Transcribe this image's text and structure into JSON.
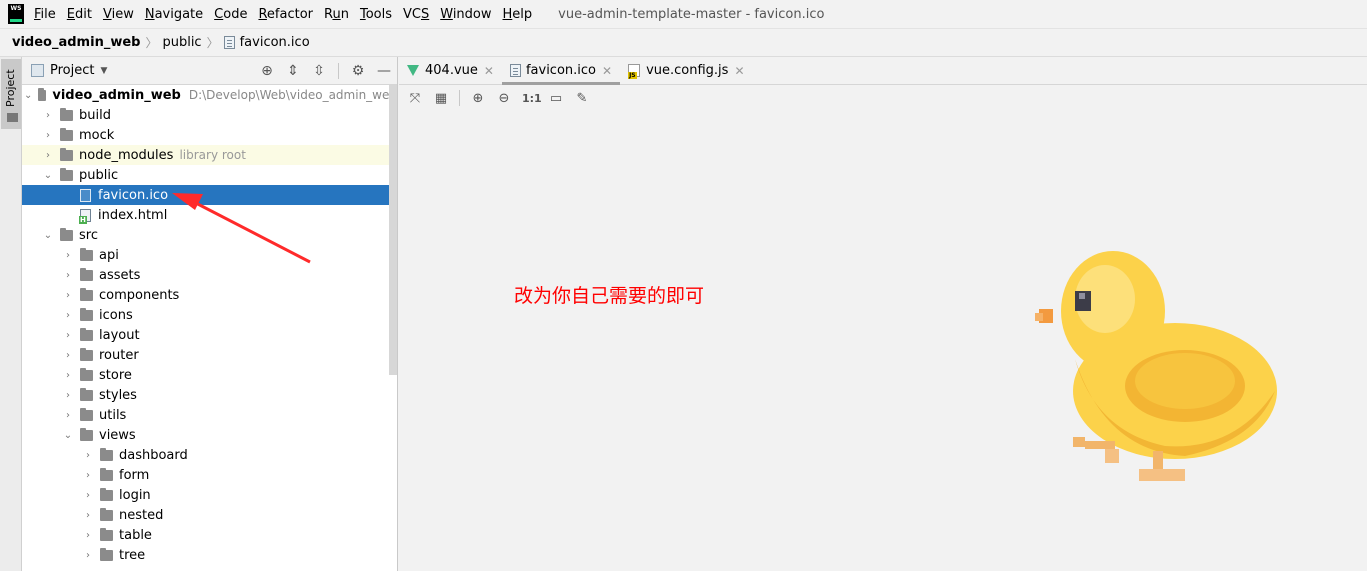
{
  "menubar": {
    "logo": "WS EAP",
    "items": [
      {
        "pre": "",
        "u": "F",
        "post": "ile"
      },
      {
        "pre": "",
        "u": "E",
        "post": "dit"
      },
      {
        "pre": "",
        "u": "V",
        "post": "iew"
      },
      {
        "pre": "",
        "u": "N",
        "post": "avigate"
      },
      {
        "pre": "",
        "u": "C",
        "post": "ode"
      },
      {
        "pre": "",
        "u": "R",
        "post": "efactor"
      },
      {
        "pre": "R",
        "u": "u",
        "post": "n"
      },
      {
        "pre": "",
        "u": "T",
        "post": "ools"
      },
      {
        "pre": "VC",
        "u": "S",
        "post": ""
      },
      {
        "pre": "",
        "u": "W",
        "post": "indow"
      },
      {
        "pre": "",
        "u": "H",
        "post": "elp"
      }
    ],
    "window_title": "vue-admin-template-master - favicon.ico"
  },
  "breadcrumb": {
    "root": "video_admin_web",
    "folder": "public",
    "file": "favicon.ico"
  },
  "left_strip": {
    "tab_label": "Project"
  },
  "project_panel": {
    "title": "Project",
    "root_name": "video_admin_web",
    "root_path": "D:\\Develop\\Web\\video_admin_web",
    "library_hint": "library root",
    "items": {
      "build": "build",
      "mock": "mock",
      "node_modules": "node_modules",
      "public": "public",
      "favicon": "favicon.ico",
      "index_html": "index.html",
      "src": "src",
      "api": "api",
      "assets": "assets",
      "components": "components",
      "icons": "icons",
      "layout": "layout",
      "router": "router",
      "store": "store",
      "styles": "styles",
      "utils": "utils",
      "views": "views",
      "dashboard": "dashboard",
      "form": "form",
      "login": "login",
      "nested": "nested",
      "table": "table",
      "tree": "tree"
    }
  },
  "editor": {
    "tabs": [
      {
        "label": "404.vue",
        "active": false
      },
      {
        "label": "favicon.ico",
        "active": true
      },
      {
        "label": "vue.config.js",
        "active": false
      }
    ],
    "toolbar": {
      "actual_size": "1:1"
    },
    "annotation": "改为你自己需要的即可",
    "annotation_color": "#ff0000"
  },
  "colors": {
    "selection": "#2675bf",
    "library_row": "#fbfbe4",
    "vue_green": "#41b883"
  }
}
